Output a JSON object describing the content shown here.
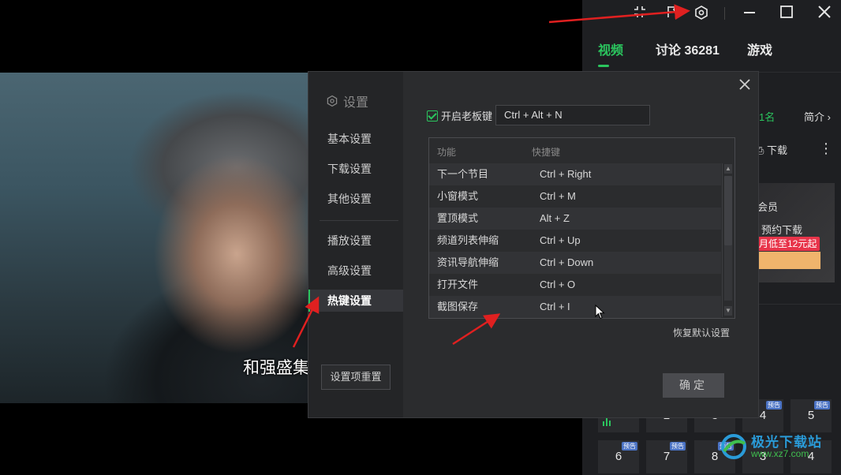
{
  "video": {
    "subtitle": "和强盛集"
  },
  "right_panel": {
    "tabs": [
      "视频",
      "讨论 36281",
      "游戏"
    ],
    "peek": {
      "rank": "1名",
      "intro": "简介",
      "download": "下载",
      "member": "会员",
      "reserve": "预约下载",
      "promo": "月低至12元起"
    },
    "episodes": [
      {
        "num": "2",
        "tag": ""
      },
      {
        "num": "3",
        "tag": ""
      },
      {
        "num": "4",
        "tag": "预告"
      },
      {
        "num": "5",
        "tag": "预告"
      },
      {
        "num": "6",
        "tag": "预告"
      },
      {
        "num": "7",
        "tag": "预告"
      },
      {
        "num": "8",
        "tag": "预告"
      },
      {
        "num": "3",
        "tag": ""
      },
      {
        "num": "4",
        "tag": ""
      }
    ],
    "watermark": "极光下载站",
    "watermark_url": "www.xz7.com"
  },
  "settings": {
    "title": "设置",
    "nav": [
      "基本设置",
      "下载设置",
      "其他设置",
      "播放设置",
      "高级设置",
      "热键设置"
    ],
    "reset_items": "设置项重置",
    "boss_key_label": "开启老板键",
    "boss_key_value": "Ctrl + Alt + N",
    "table_header": {
      "func": "功能",
      "key": "快捷键"
    },
    "rows": [
      {
        "func": "下一个节目",
        "key": "Ctrl + Right"
      },
      {
        "func": "小窗模式",
        "key": "Ctrl + M"
      },
      {
        "func": "置顶模式",
        "key": "Alt + Z"
      },
      {
        "func": "频道列表伸缩",
        "key": "Ctrl + Up"
      },
      {
        "func": "资讯导航伸缩",
        "key": "Ctrl + Down"
      },
      {
        "func": "打开文件",
        "key": "Ctrl + O"
      },
      {
        "func": "截图保存",
        "key": "Ctrl + I"
      }
    ],
    "restore_default": "恢复默认设置",
    "ok": "确定"
  },
  "colors": {
    "accent": "#2bc55e",
    "arrow": "#e02020"
  }
}
